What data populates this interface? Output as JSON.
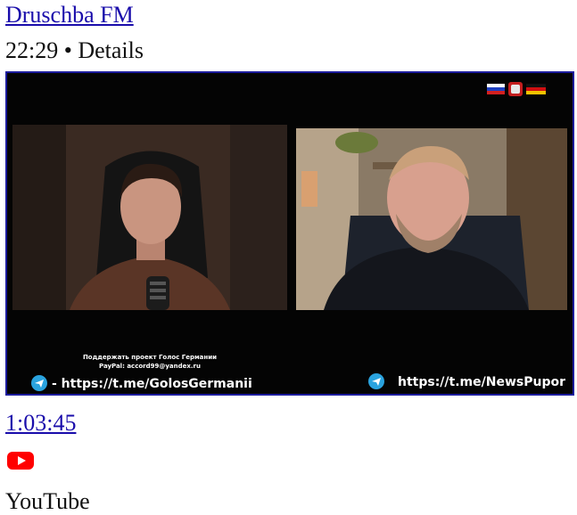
{
  "channel": {
    "name": "Druschba FM"
  },
  "meta": {
    "time": "22:29",
    "separator": "•",
    "details_label": "Details",
    "line": "22:29 • Details"
  },
  "thumbnail": {
    "overlay_line1": "Поддержать проект Голос Германии",
    "overlay_line2": "PayPal: accord99@yandex.ru",
    "left_link": "- https://t.me/GolosGermanii",
    "right_link": "https://t.me/NewsPupor",
    "logo_icon": "flags-logo-icon",
    "colors": {
      "frame": "#1c1c9c",
      "background": "#040404",
      "telegram": "#2aa3df"
    }
  },
  "video": {
    "duration": "1:03:45"
  },
  "source": {
    "icon": "youtube-icon",
    "label": "YouTube",
    "brand_color": "#ff0000"
  }
}
